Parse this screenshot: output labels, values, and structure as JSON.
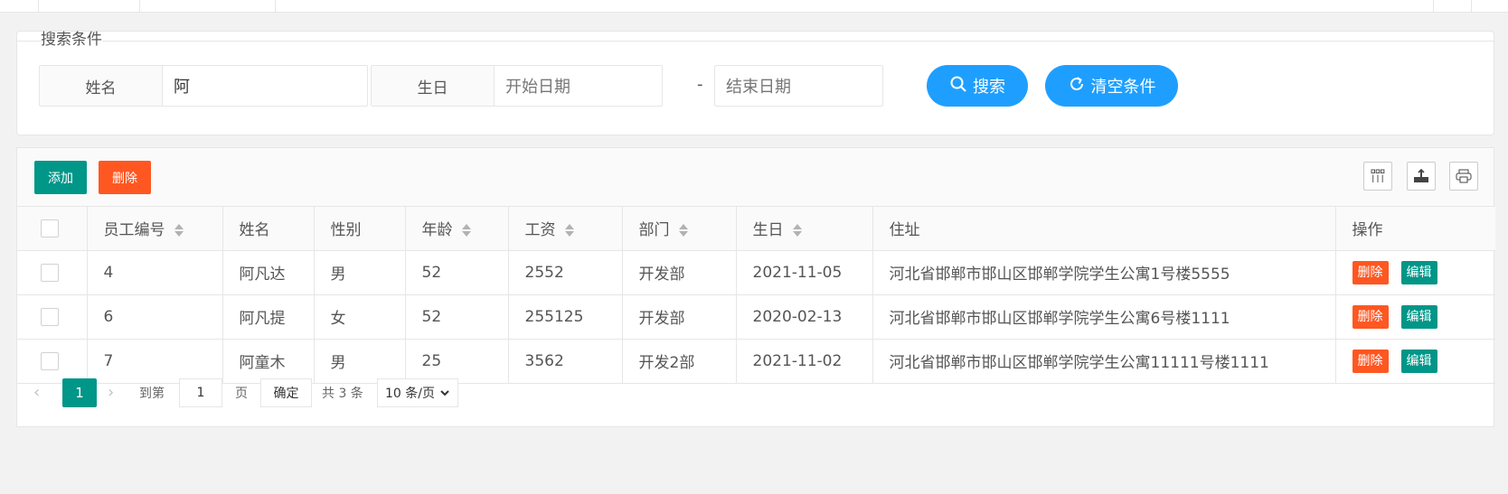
{
  "search": {
    "legend": "搜索条件",
    "name_label": "姓名",
    "name_value": "阿",
    "birthday_label": "生日",
    "start_placeholder": "开始日期",
    "end_placeholder": "结束日期",
    "dash": "-",
    "search_button": "搜索",
    "clear_button": "清空条件",
    "search_color": "#1e9fff"
  },
  "toolbar": {
    "add_label": "添加",
    "delete_label": "删除",
    "add_color": "#009688",
    "delete_color": "#ff5722",
    "icons": [
      "columns-icon",
      "export-icon",
      "print-icon"
    ]
  },
  "table": {
    "columns": [
      "员工编号",
      "姓名",
      "性别",
      "年龄",
      "工资",
      "部门",
      "生日",
      "住址",
      "操作"
    ],
    "rows": [
      {
        "id": "4",
        "name": "阿凡达",
        "gender": "男",
        "age": "52",
        "salary": "2552",
        "dept": "开发部",
        "birthday": "2021-11-05",
        "address": "河北省邯郸市邯山区邯郸学院学生公寓1号楼5555"
      },
      {
        "id": "6",
        "name": "阿凡提",
        "gender": "女",
        "age": "52",
        "salary": "255125",
        "dept": "开发部",
        "birthday": "2020-02-13",
        "address": "河北省邯郸市邯山区邯郸学院学生公寓6号楼1111"
      },
      {
        "id": "7",
        "name": "阿童木",
        "gender": "男",
        "age": "25",
        "salary": "3562",
        "dept": "开发2部",
        "birthday": "2021-11-02",
        "address": "河北省邯郸市邯山区邯郸学院学生公寓11111号楼1111"
      }
    ],
    "row_delete": "删除",
    "row_edit": "编辑"
  },
  "pager": {
    "current_page": "1",
    "goto_label": "到第",
    "goto_value": "1",
    "page_unit": "页",
    "confirm": "确定",
    "total": "共 3 条",
    "page_size": "10 条/页"
  }
}
